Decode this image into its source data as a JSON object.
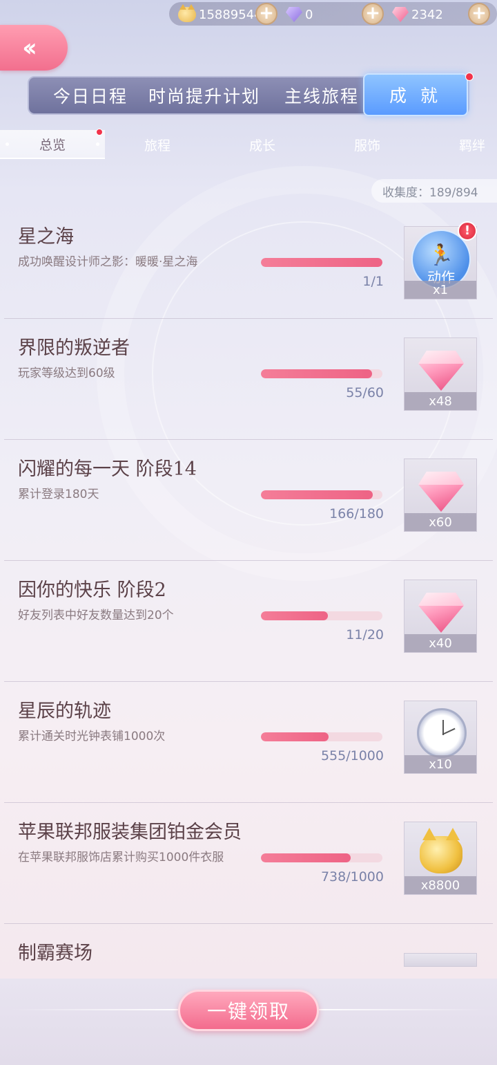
{
  "currency": {
    "coins": "15889544",
    "crystals": "0",
    "diamonds": "2342"
  },
  "main_tabs": [
    "今日日程",
    "时尚提升计划",
    "主线旅程",
    "成 就"
  ],
  "sub_tabs": [
    "总览",
    "旅程",
    "成长",
    "服饰",
    "羁绊"
  ],
  "collection": "收集度：189/894",
  "achievements": [
    {
      "title": "星之海",
      "desc": "成功唤醒设计师之影：暖暖·星之海",
      "progress": "1/1",
      "ratio": 1.0,
      "reward_count": "x1",
      "reward_type": "action-icon",
      "reward_label": "动作",
      "alert": "!"
    },
    {
      "title": "界限的叛逆者",
      "desc": "玩家等级达到60级",
      "progress": "55/60",
      "ratio": 0.917,
      "reward_count": "x48",
      "reward_type": "diamond-icon"
    },
    {
      "title": "闪耀的每一天 阶段14",
      "desc": "累计登录180天",
      "progress": "166/180",
      "ratio": 0.922,
      "reward_count": "x60",
      "reward_type": "diamond-icon"
    },
    {
      "title": "因你的快乐 阶段2",
      "desc": "好友列表中好友数量达到20个",
      "progress": "11/20",
      "ratio": 0.55,
      "reward_count": "x40",
      "reward_type": "diamond-icon"
    },
    {
      "title": "星辰的轨迹",
      "desc": "累计通关时光钟表铺1000次",
      "progress": "555/1000",
      "ratio": 0.555,
      "reward_count": "x10",
      "reward_type": "clock-icon"
    },
    {
      "title": "苹果联邦服装集团铂金会员",
      "desc": "在苹果联邦服饰店累计购买1000件衣服",
      "progress": "738/1000",
      "ratio": 0.738,
      "reward_count": "x8800",
      "reward_type": "cat-coin-icon"
    },
    {
      "title": "制霸赛场"
    }
  ],
  "claim_all": "一键领取",
  "colors": {
    "accent_pink": "#f26f8e",
    "tab_active_blue": "#5a9bff",
    "progress_fill": "#ee6385"
  }
}
